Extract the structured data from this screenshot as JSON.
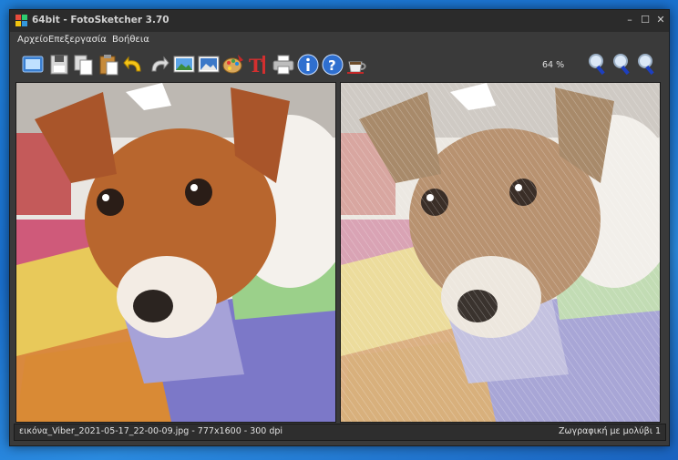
{
  "window": {
    "title": "64bit - FotoSketcher 3.70"
  },
  "window_controls": {
    "minimize": "–",
    "maximize": "☐",
    "close": "✕"
  },
  "menu": {
    "items": [
      "Αρχείο",
      "Επεξεργασία",
      "Βοήθεια"
    ]
  },
  "toolbar": {
    "zoom_level": "64 %",
    "buttons": [
      "open-image-icon",
      "save-icon",
      "copy-icon",
      "paste-icon",
      "undo-icon",
      "redo-icon",
      "original-image-icon",
      "drawing-icon",
      "palette-icon",
      "text-icon",
      "print-icon",
      "info-icon",
      "help-icon",
      "coffee-icon",
      "zoom-in-icon",
      "zoom-reset-icon",
      "zoom-out-icon"
    ]
  },
  "status": {
    "file_info": "εικόνα_Viber_2021-05-17_22-00-09.jpg - 777x1600 - 300 dpi",
    "effect": "Ζωγραφική με μολύβι 1"
  },
  "colors": {
    "accent": "#1e7bd6",
    "window_bg": "#3a3a3a"
  }
}
